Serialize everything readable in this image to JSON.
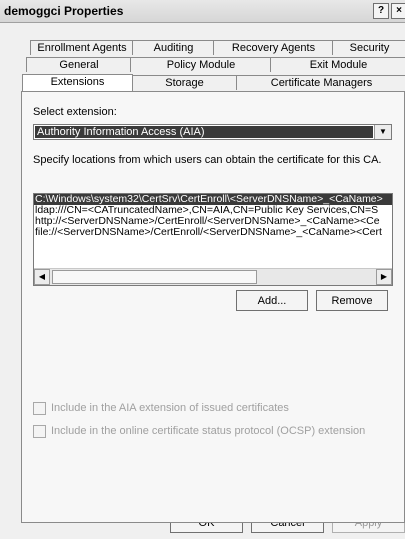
{
  "window": {
    "title": "demoggci Properties",
    "help_glyph": "?",
    "close_glyph": "×"
  },
  "tabs": {
    "row1": [
      "Enrollment Agents",
      "Auditing",
      "Recovery Agents",
      "Security"
    ],
    "row2": [
      "General",
      "Policy Module",
      "Exit Module"
    ],
    "row3": [
      "Extensions",
      "Storage",
      "Certificate Managers"
    ],
    "active": "Extensions"
  },
  "extension": {
    "label": "Select extension:",
    "selected": "Authority Information Access (AIA)"
  },
  "locations": {
    "label": "Specify locations from which users can obtain the certificate for this CA.",
    "items": [
      "C:\\Windows\\system32\\CertSrv\\CertEnroll\\<ServerDNSName>_<CaName>",
      "ldap:///CN=<CATruncatedName>,CN=AIA,CN=Public Key Services,CN=S",
      "http://<ServerDNSName>/CertEnroll/<ServerDNSName>_<CaName><Ce",
      "file://<ServerDNSName>/CertEnroll/<ServerDNSName>_<CaName><Cert"
    ]
  },
  "buttons": {
    "add": "Add...",
    "remove": "Remove",
    "ok": "OK",
    "cancel": "Cancel",
    "apply": "Apply"
  },
  "options": {
    "aia": "Include in the AIA extension of issued certificates",
    "ocsp": "Include in the online certificate status protocol (OCSP) extension"
  },
  "icons": {
    "dropdown": "chevron-down-icon",
    "scroll_left": "arrow-left-icon",
    "scroll_right": "arrow-right-icon"
  }
}
